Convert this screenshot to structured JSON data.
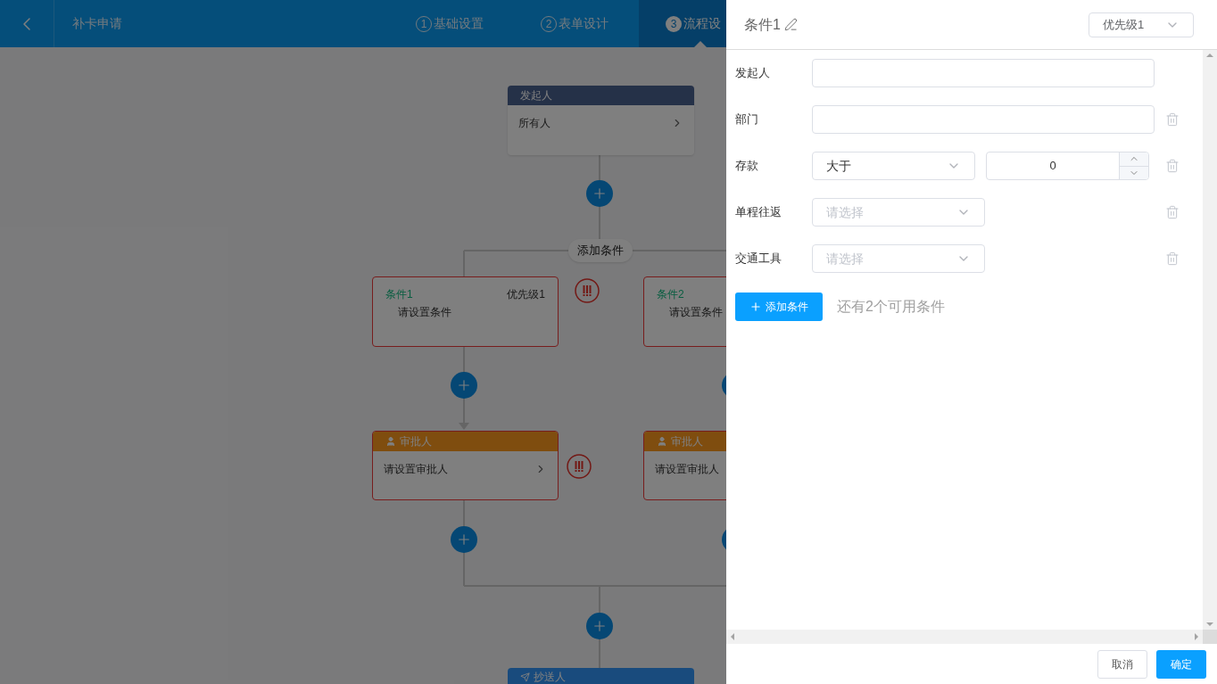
{
  "header": {
    "title": "补卡申请",
    "steps": [
      {
        "number": "1",
        "label": "基础设置",
        "selected": false
      },
      {
        "number": "2",
        "label": "表单设计",
        "selected": false
      },
      {
        "number": "3",
        "label": "流程设",
        "selected": true
      }
    ]
  },
  "flow": {
    "start": {
      "title": "发起人",
      "value": "所有人"
    },
    "add_condition": "添加条件",
    "branches": [
      {
        "condition": {
          "name": "条件1",
          "priority": "优先级1",
          "text": "请设置条件",
          "error": true
        },
        "approver": {
          "title": "审批人",
          "value": "请设置审批人",
          "error": true
        }
      },
      {
        "condition": {
          "name": "条件2",
          "text": "请设置条件",
          "error": true
        },
        "approver": {
          "title": "审批人",
          "value": "请设置审批人",
          "error": true
        }
      }
    ],
    "cc": {
      "title": "抄送人"
    }
  },
  "drawer": {
    "title": "条件1",
    "priority": "优先级1",
    "rows": [
      {
        "kind": "input",
        "label": "发起人",
        "deletable": false
      },
      {
        "kind": "input",
        "label": "部门",
        "deletable": true
      },
      {
        "kind": "compare",
        "label": "存款",
        "operator": "大于",
        "value": "0",
        "deletable": true
      },
      {
        "kind": "select",
        "label": "单程往返",
        "placeholder": "请选择",
        "deletable": true
      },
      {
        "kind": "select",
        "label": "交通工具",
        "placeholder": "请选择",
        "deletable": true
      }
    ],
    "add_button": "添加条件",
    "hint": "还有2个可用条件",
    "cancel": "取消",
    "confirm": "确定"
  }
}
